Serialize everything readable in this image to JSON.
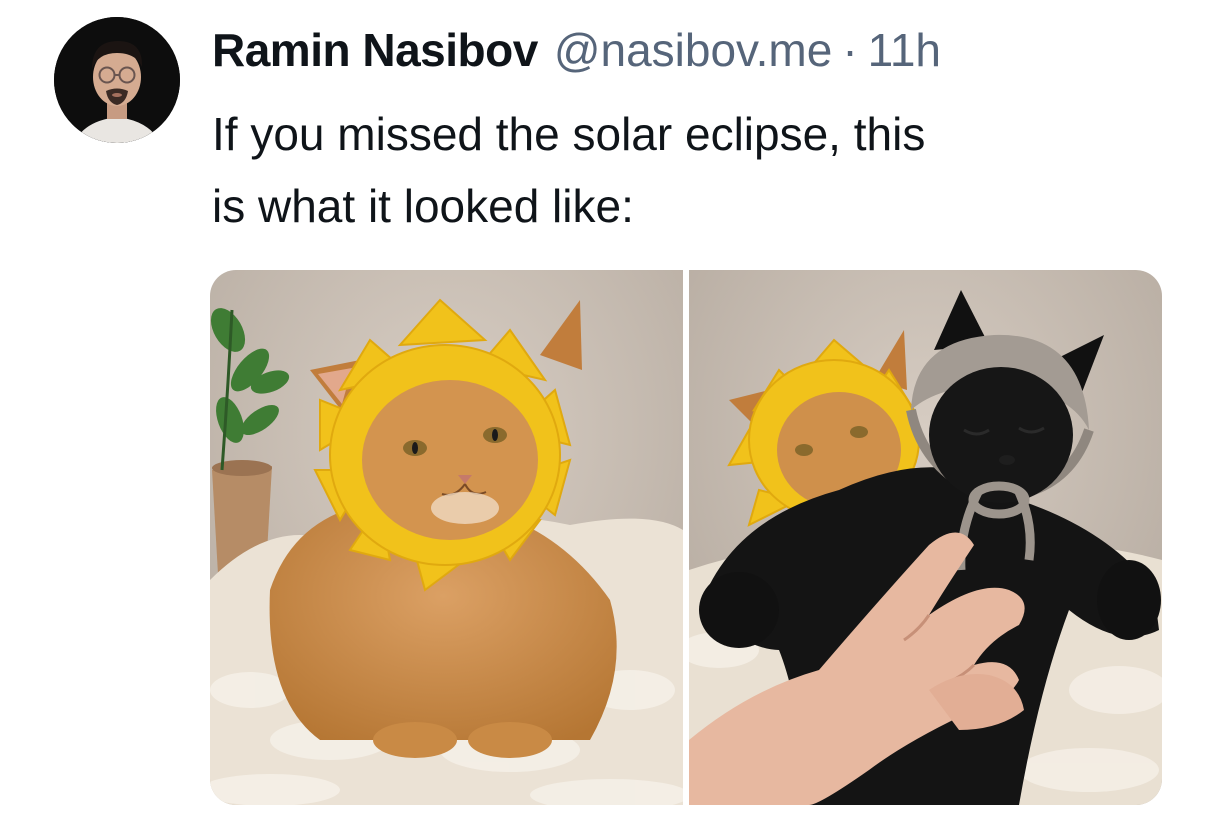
{
  "post": {
    "author_name": "Ramin Nasibov",
    "author_handle": "@nasibov.me",
    "separator": "·",
    "timestamp": "11h",
    "text_line1": "If you missed the solar eclipse, this",
    "text_line2": "is what it looked like:"
  },
  "media": [
    {
      "subject": "orange cat wearing a yellow crocheted sun hat"
    },
    {
      "subject": "black cat in grey crocheted bonnet held in front of orange cat in sun hat"
    }
  ],
  "colors": {
    "name": "#0f1419",
    "handle": "#56657a",
    "sun_yellow": "#f1c21b",
    "orange_cat": "#c98a45",
    "black_cat": "#141414",
    "background_wall": "#c9bdb2",
    "blanket": "#ece4d8"
  }
}
